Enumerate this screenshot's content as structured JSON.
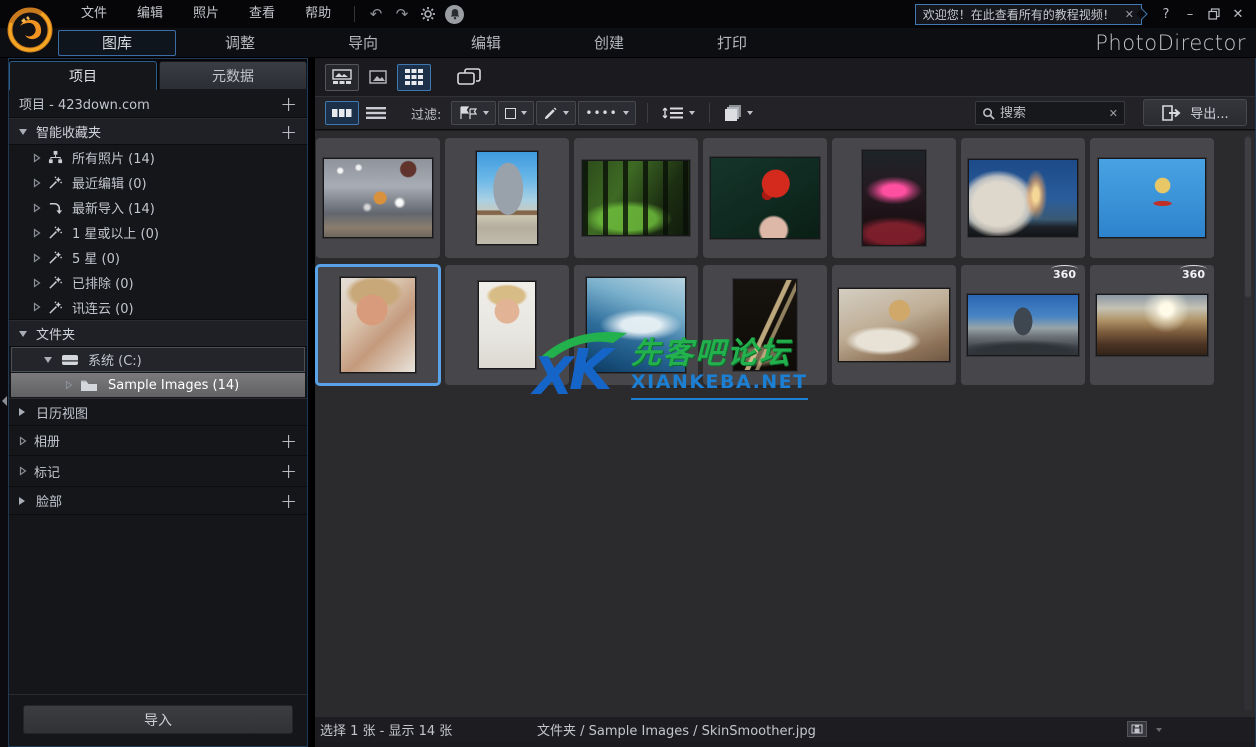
{
  "titlebar": {
    "menus": [
      "文件",
      "编辑",
      "照片",
      "查看",
      "帮助"
    ],
    "welcome_tip": "欢迎您！在此查看所有的教程视频！",
    "icons": {
      "undo": "↶",
      "redo": "↷",
      "help": "?",
      "minimize": "–",
      "close": "✕",
      "tip_close": "✕"
    }
  },
  "modebar": {
    "tabs": [
      {
        "label": "图库",
        "active": true
      },
      {
        "label": "调整",
        "active": false
      },
      {
        "label": "导向",
        "active": false
      },
      {
        "label": "编辑",
        "active": false
      },
      {
        "label": "创建",
        "active": false
      },
      {
        "label": "打印",
        "active": false
      }
    ],
    "app_title": "PhotoDirector"
  },
  "sidebar": {
    "tabs": [
      {
        "label": "项目",
        "active": true
      },
      {
        "label": "元数据",
        "active": false
      }
    ],
    "project_label": "项目 - 423down.com",
    "smart_header": "智能收藏夹",
    "smart_items": [
      {
        "label": "所有照片 (14)",
        "icon": "photos-tree-icon"
      },
      {
        "label": "最近编辑 (0)",
        "icon": "wand-icon"
      },
      {
        "label": "最新导入 (14)",
        "icon": "import-icon"
      },
      {
        "label": "1 星或以上 (0)",
        "icon": "wand-icon"
      },
      {
        "label": "5 星 (0)",
        "icon": "wand-icon"
      },
      {
        "label": "已排除 (0)",
        "icon": "wand-icon"
      },
      {
        "label": "讯连云 (0)",
        "icon": "wand-icon"
      }
    ],
    "folders_header": "文件夹",
    "drive_label": "系统 (C:)",
    "folder_label": "Sample Images (14)",
    "calendar_label": "日历视图",
    "albums_label": "相册",
    "tags_label": "标记",
    "faces_label": "脸部",
    "plus": "+",
    "import_button": "导入"
  },
  "toolbar": {
    "filter_label": "过滤:",
    "dots_icon": "••••",
    "search_placeholder": "搜索",
    "search_clear": "✕",
    "export_label": "导出..."
  },
  "grid": {
    "badge_360": "360",
    "photo_count": 14,
    "selected_index": 8
  },
  "statusbar": {
    "selection": "选择 1 张 - 显示 14 张",
    "path": "文件夹 / Sample Images / SkinSmoother.jpg"
  },
  "watermark": {
    "logo_x": "X",
    "logo_k": "K",
    "line1": "先客吧论坛",
    "line2": "XIANKEBA.NET",
    "green": "#22b14c",
    "blue": "#1b7fd4"
  },
  "colors": {
    "accent_border": "#3f7ab5",
    "selection_border": "#5aa2e8",
    "logo_orange": "#f29422"
  }
}
